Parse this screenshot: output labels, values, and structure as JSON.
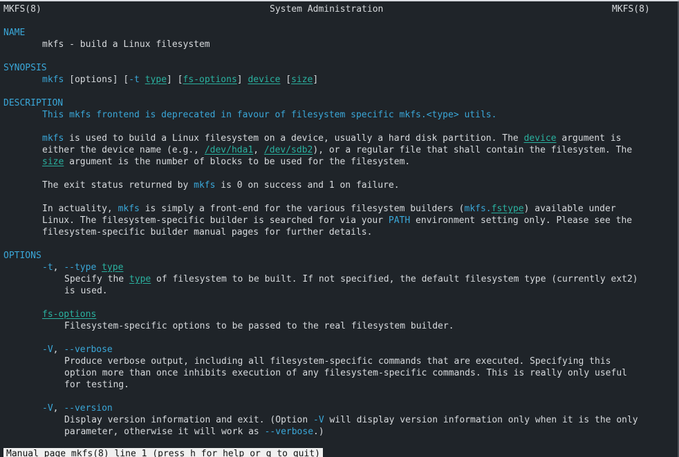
{
  "header": {
    "left": "MKFS(8)",
    "center": "System Administration",
    "right": "MKFS(8)"
  },
  "sections": {
    "name": "NAME",
    "synopsis": "SYNOPSIS",
    "description": "DESCRIPTION",
    "options": "OPTIONS"
  },
  "name": {
    "line": "mkfs - build a Linux filesystem"
  },
  "synopsis": {
    "cmd": "mkfs",
    "t1": " [options] [",
    "t_flag": "-t",
    "t2": " ",
    "type": "type",
    "t3": "] [",
    "fs_options": "fs-options",
    "t4": "] ",
    "device": "device",
    "t5": " [",
    "size": "size",
    "t6": "]"
  },
  "description": {
    "deprecated": "This mkfs frontend is deprecated in favour of filesystem specific mkfs.<type> utils.",
    "p1_l1_cmd": "mkfs",
    "p1_l1_a": " is used to build a Linux filesystem on a device, usually a hard disk partition. The ",
    "p1_l1_device": "device",
    "p1_l1_b": " argument is",
    "p1_l2_a": "either the device name (e.g., ",
    "p1_l2_hda1": "/dev/hda1",
    "p1_l2_b": ", ",
    "p1_l2_sdb2": "/dev/sdb2",
    "p1_l2_c": "), or a regular file that shall contain the filesystem. The",
    "p1_l3_size": "size",
    "p1_l3_a": " argument is the number of blocks to be used for the filesystem.",
    "p2_a": "The exit status returned by ",
    "p2_cmd": "mkfs",
    "p2_b": " is 0 on success and 1 on failure.",
    "p3_l1_a": "In actuality, ",
    "p3_l1_cmd": "mkfs",
    "p3_l1_b": " is simply a front-end for the various filesystem builders (",
    "p3_l1_mkfs": "mkfs.",
    "p3_l1_fstype": "fstype",
    "p3_l1_c": ") available under",
    "p3_l2_a": "Linux. The filesystem-specific builder is searched for via your ",
    "p3_l2_path": "PATH",
    "p3_l2_b": " environment setting only. Please see the",
    "p3_l3": "filesystem-specific builder manual pages for further details."
  },
  "options": {
    "type_flag_short": "-t",
    "type_sep": ", ",
    "type_flag_long": "--type",
    "type_sp": " ",
    "type_arg": "type",
    "type_desc_a": "Specify the ",
    "type_desc_type": "type",
    "type_desc_b": " of filesystem to be built. If not specified, the default filesystem type (currently ext2)",
    "type_desc_c": "is used.",
    "fs_options": "fs-options",
    "fs_options_desc": "Filesystem-specific options to be passed to the real filesystem builder.",
    "verbose_short": "-V",
    "verbose_sep": ", ",
    "verbose_long": "--verbose",
    "verbose_l1": "Produce verbose output, including all filesystem-specific commands that are executed. Specifying this",
    "verbose_l2": "option more than once inhibits execution of any filesystem-specific commands. This is really only useful",
    "verbose_l3": "for testing.",
    "version_short": "-V",
    "version_sep": ", ",
    "version_long": "--version",
    "version_l1_a": "Display version information and exit. (Option ",
    "version_l1_flag": "-V",
    "version_l1_b": " will display version information only when it is the only",
    "version_l2_a": "parameter, otherwise it will work as ",
    "version_l2_flag": "--verbose",
    "version_l2_b": ".)"
  },
  "status_line": "Manual page mkfs(8) line 1 (press h for help or q to quit)",
  "colors": {
    "background": "#1f2429",
    "text": "#d7dadd",
    "heading": "#3aa7d8",
    "link": "#2ab2a0",
    "status_bg": "#f0f0f0"
  }
}
